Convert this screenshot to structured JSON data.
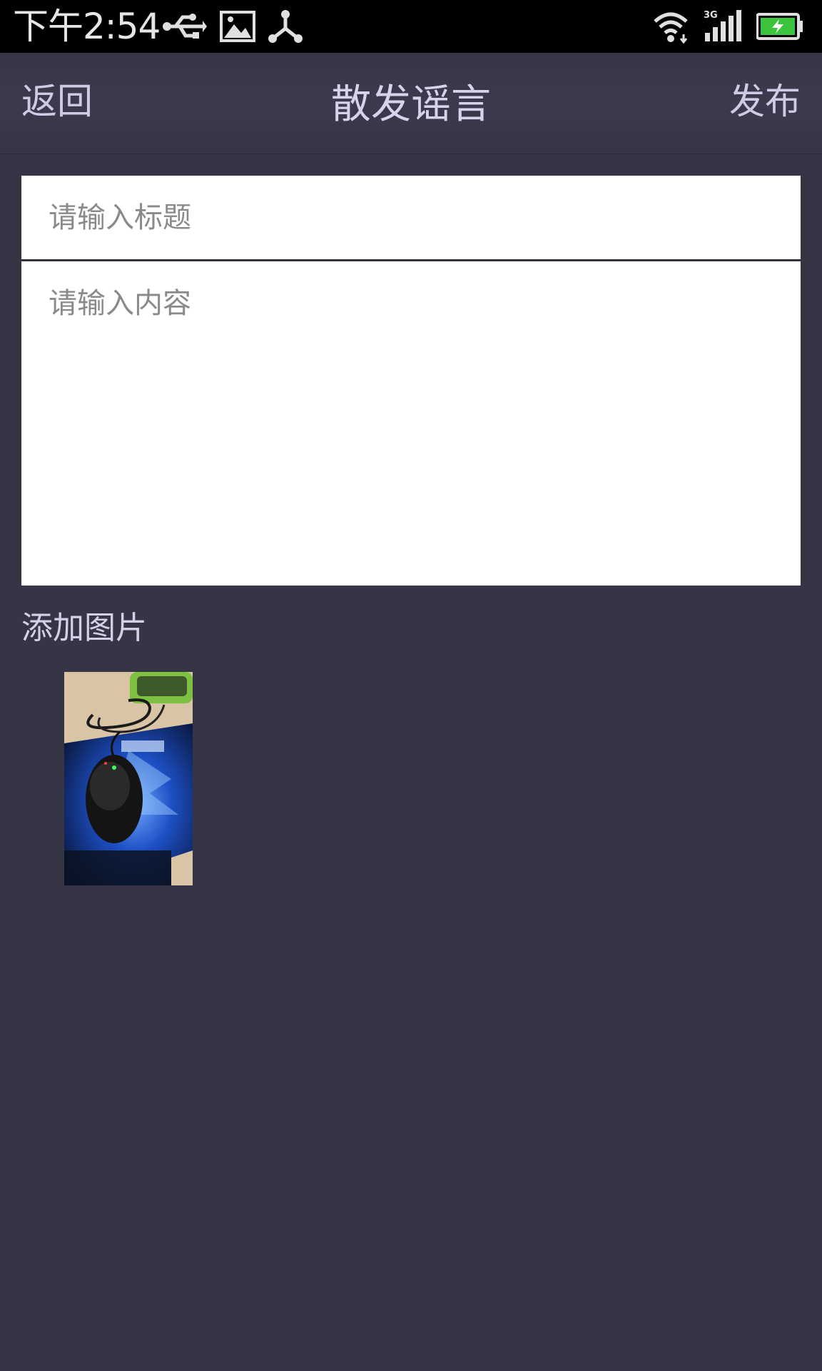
{
  "status_bar": {
    "time": "下午2:54",
    "icons": [
      "usb-icon",
      "image-icon",
      "share-icon",
      "wifi-icon",
      "signal-3g-icon",
      "battery-charging-icon"
    ]
  },
  "header": {
    "back_label": "返回",
    "title": "散发谣言",
    "publish_label": "发布"
  },
  "form": {
    "title_placeholder": "请输入标题",
    "title_value": "",
    "content_placeholder": "请输入内容",
    "content_value": ""
  },
  "attachments": {
    "label": "添加图片",
    "images": [
      {
        "icon": "photo-thumbnail-mouse"
      }
    ]
  },
  "colors": {
    "background": "#363546",
    "status_bar": "#000000",
    "header_text": "#cfcbe6",
    "input_background": "#ffffff",
    "placeholder": "#8a8a8a",
    "battery_green": "#3cc43c"
  }
}
